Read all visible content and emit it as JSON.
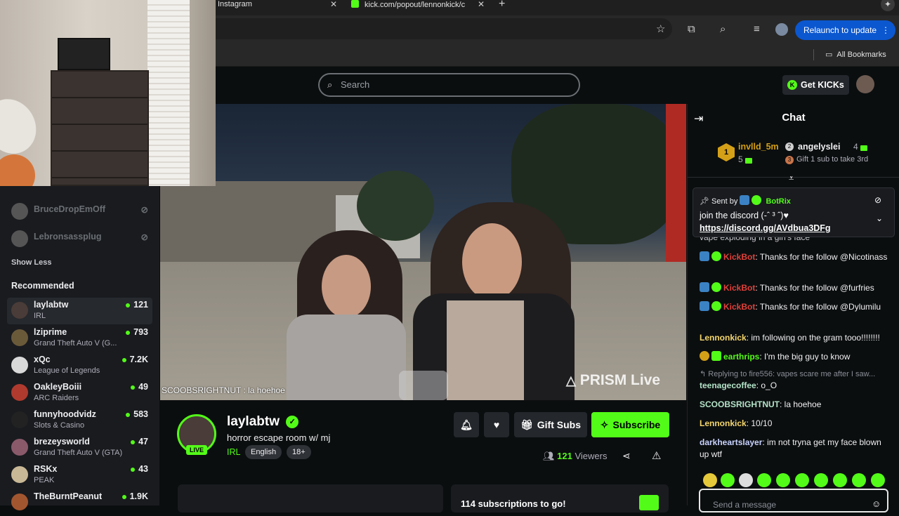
{
  "browser": {
    "tabs": [
      {
        "label": "Instagram"
      },
      {
        "label": "kick.com/popout/lennonkick/c"
      }
    ],
    "relaunch_label": "Relaunch to update",
    "bookmarks_label": "All Bookmarks"
  },
  "header": {
    "search_placeholder": "Search",
    "get_kicks_label": "Get KICKs"
  },
  "sidebar": {
    "followed": [
      {
        "name": "BruceDropEmOff"
      },
      {
        "name": "Lebronsassplug"
      }
    ],
    "show_less": "Show Less",
    "recommended_title": "Recommended",
    "recommended": [
      {
        "name": "laylabtw",
        "category": "IRL",
        "viewers": "121"
      },
      {
        "name": "lziprime",
        "category": "Grand Theft Auto V (G...",
        "viewers": "793"
      },
      {
        "name": "xQc",
        "category": "League of Legends",
        "viewers": "7.2K"
      },
      {
        "name": "OakleyBoiii",
        "category": "ARC Raiders",
        "viewers": "49"
      },
      {
        "name": "funnyhoodvidz",
        "category": "Slots & Casino",
        "viewers": "583"
      },
      {
        "name": "brezeysworld",
        "category": "Grand Theft Auto V (GTA)",
        "viewers": "47"
      },
      {
        "name": "RSKx",
        "category": "PEAK",
        "viewers": "43"
      },
      {
        "name": "TheBurntPeanut",
        "category": "",
        "viewers": "1.9K"
      }
    ]
  },
  "video": {
    "overlay_chat": "SCOOBSRIGHTNUT : la hoehoe",
    "watermark": "PRISM Live"
  },
  "stream": {
    "channel": "laylabtw",
    "title": "horror escape room w/ mj",
    "category": "IRL",
    "tags": [
      "English",
      "18+"
    ],
    "live_label": "LIVE",
    "viewers": "121",
    "viewers_label": "Viewers",
    "gift_subs_label": "Gift Subs",
    "subscribe_label": "Subscribe",
    "sub_goal": "114 subscriptions to go!"
  },
  "chat": {
    "title": "Chat",
    "leaderboard": [
      {
        "rank": "1",
        "name": "invlld_5m",
        "count": "5"
      },
      {
        "rank": "2",
        "name": "angelyslei",
        "count": "4"
      }
    ],
    "gift_prompt": "Gift 1 sub to take 3rd",
    "pinned": {
      "sent_by_label": "Sent by",
      "sender": "BotRix",
      "text": "join the discord (-ˆ ³ ˆ)♥",
      "link": "https://discord.gg/AVdbua3DFg"
    },
    "partial_line": "vape exploding in a girl's face",
    "messages": [
      {
        "user": "KickBot",
        "text": "Thanks for the follow @Nicotinass",
        "color": "#e0403a"
      },
      {
        "user": "KickBot",
        "text": "Thanks for the follow @furfries",
        "color": "#e0403a"
      },
      {
        "user": "KickBot",
        "text": "Thanks for the follow @Dylumilu",
        "color": "#e0403a"
      },
      {
        "user": "Lennonkick",
        "text": "im following on the gram tooo!!!!!!!!",
        "color": "#f5d76e"
      },
      {
        "user": "earthrips",
        "text": "I'm the big guy to know",
        "color": "#53fc18"
      },
      {
        "reply": "Replying to fire556: vapes scare me after I saw..."
      },
      {
        "user": "teenagecoffee",
        "text": "o_O",
        "color": "#b4e3c8"
      },
      {
        "user": "SCOOBSRIGHTNUT",
        "text": "la hoehoe",
        "color": "#b4e3c8"
      },
      {
        "user": "Lennonkick",
        "text": "10/10",
        "color": "#f5d76e"
      },
      {
        "user": "darkheartslayer",
        "text": "im not tryna get my face blown up wtf",
        "color": "#c8d3ff"
      }
    ],
    "input_placeholder": "Send a message"
  },
  "colors": {
    "accent": "#53fc18",
    "bg": "#0b0e0f"
  }
}
